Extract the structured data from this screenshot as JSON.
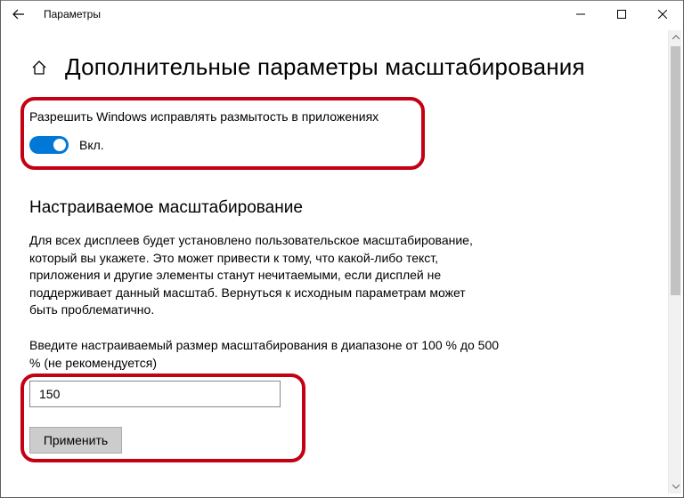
{
  "titlebar": {
    "title": "Параметры"
  },
  "page": {
    "title": "Дополнительные параметры масштабирования"
  },
  "fixBlur": {
    "label": "Разрешить Windows исправлять размытость в приложениях",
    "status": "Вкл."
  },
  "customScaling": {
    "heading": "Настраиваемое масштабирование",
    "description": "Для всех дисплеев будет установлено пользовательское масштабирование, который вы укажете. Это может привести к тому, что какой-либо текст, приложения и другие элементы станут нечитаемыми, если дисплей не поддерживает данный масштаб. Вернуться к исходным параметрам может быть проблематично.",
    "prompt": "Введите настраиваемый размер масштабирования в диапазоне от 100 % до 500 % (не рекомендуется)",
    "value": "150",
    "applyLabel": "Применить"
  }
}
